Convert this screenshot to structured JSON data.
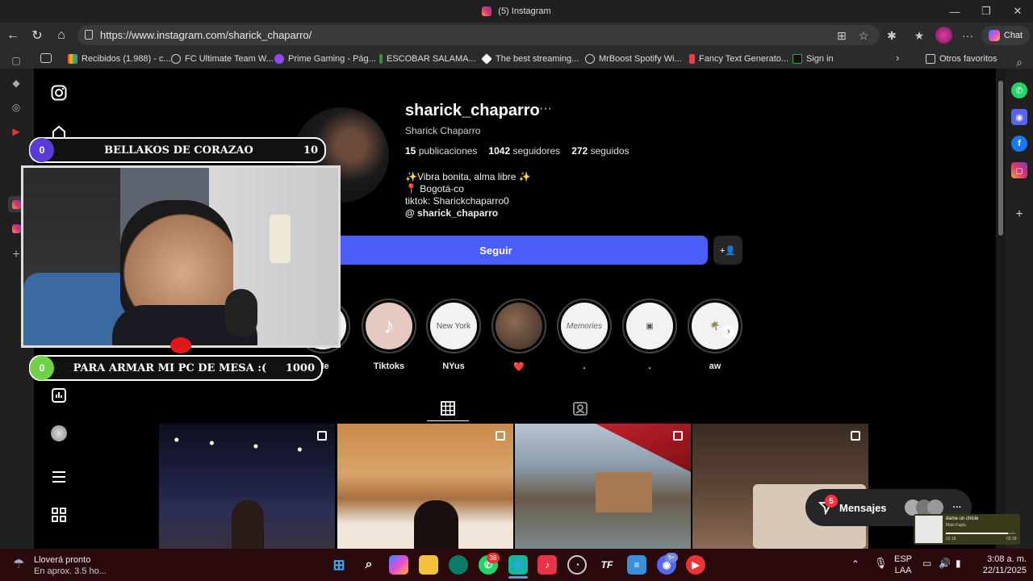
{
  "window": {
    "title": "(5) Instagram"
  },
  "browser": {
    "url": "https://www.instagram.com/sharick_chaparro/",
    "chat_label": "Chat",
    "bookmarks": [
      "Recibidos (1.988) - c...",
      "FC Ultimate Team W...",
      "Prime Gaming - Pág...",
      "ESCOBAR SALAMA...",
      "The best streaming...",
      "MrBoost Spotify Wi...",
      "Fancy Text Generato...",
      "Sign in"
    ],
    "other_favorites": "Otros favoritos"
  },
  "profile": {
    "username": "sharick_chaparro",
    "more": "···",
    "full_name": "Sharick Chaparro",
    "posts_count": "15",
    "posts_label": "publicaciones",
    "followers_count": "1042",
    "followers_label": "seguidores",
    "following_count": "272",
    "following_label": "seguidos",
    "bio_line1": "✨Vibra bonita, alma libre ✨",
    "bio_line2": "📍 Bogotá-co",
    "bio_line3": "tiktok: Sharickchaparro0",
    "threads_handle": "sharick_chaparro",
    "follow_button": "Seguir"
  },
  "highlights": [
    {
      "label": "Me"
    },
    {
      "label": "Tiktoks"
    },
    {
      "label": "NYus"
    },
    {
      "label": "❤️"
    },
    {
      "label": "."
    },
    {
      "label": "."
    },
    {
      "label": "aw"
    }
  ],
  "overlays": {
    "goal_top": {
      "left": "0",
      "text": "BELLAKOS DE CORAZAO",
      "right": "10"
    },
    "goal_bottom": {
      "left": "0",
      "text": "PARA ARMAR MI PC DE MESA :(",
      "right": "1000"
    }
  },
  "messages": {
    "label": "Mensajes",
    "badge": "5"
  },
  "music": {
    "title": "dame un chicle",
    "artist": "Mala Fagla",
    "time_start": "02:18",
    "time_end": "02:28"
  },
  "taskbar": {
    "weather_title": "Lloverá pronto",
    "weather_sub": "En aprox. 3.5 ho...",
    "whatsapp_badge": "38",
    "discord_badge": "9+",
    "lang1": "ESP",
    "lang2": "LAA",
    "time": "3:08 a. m.",
    "date": "22/11/2025"
  },
  "colors": {
    "accent": "#4a5df9",
    "taskbar": "#2b0a0e"
  }
}
